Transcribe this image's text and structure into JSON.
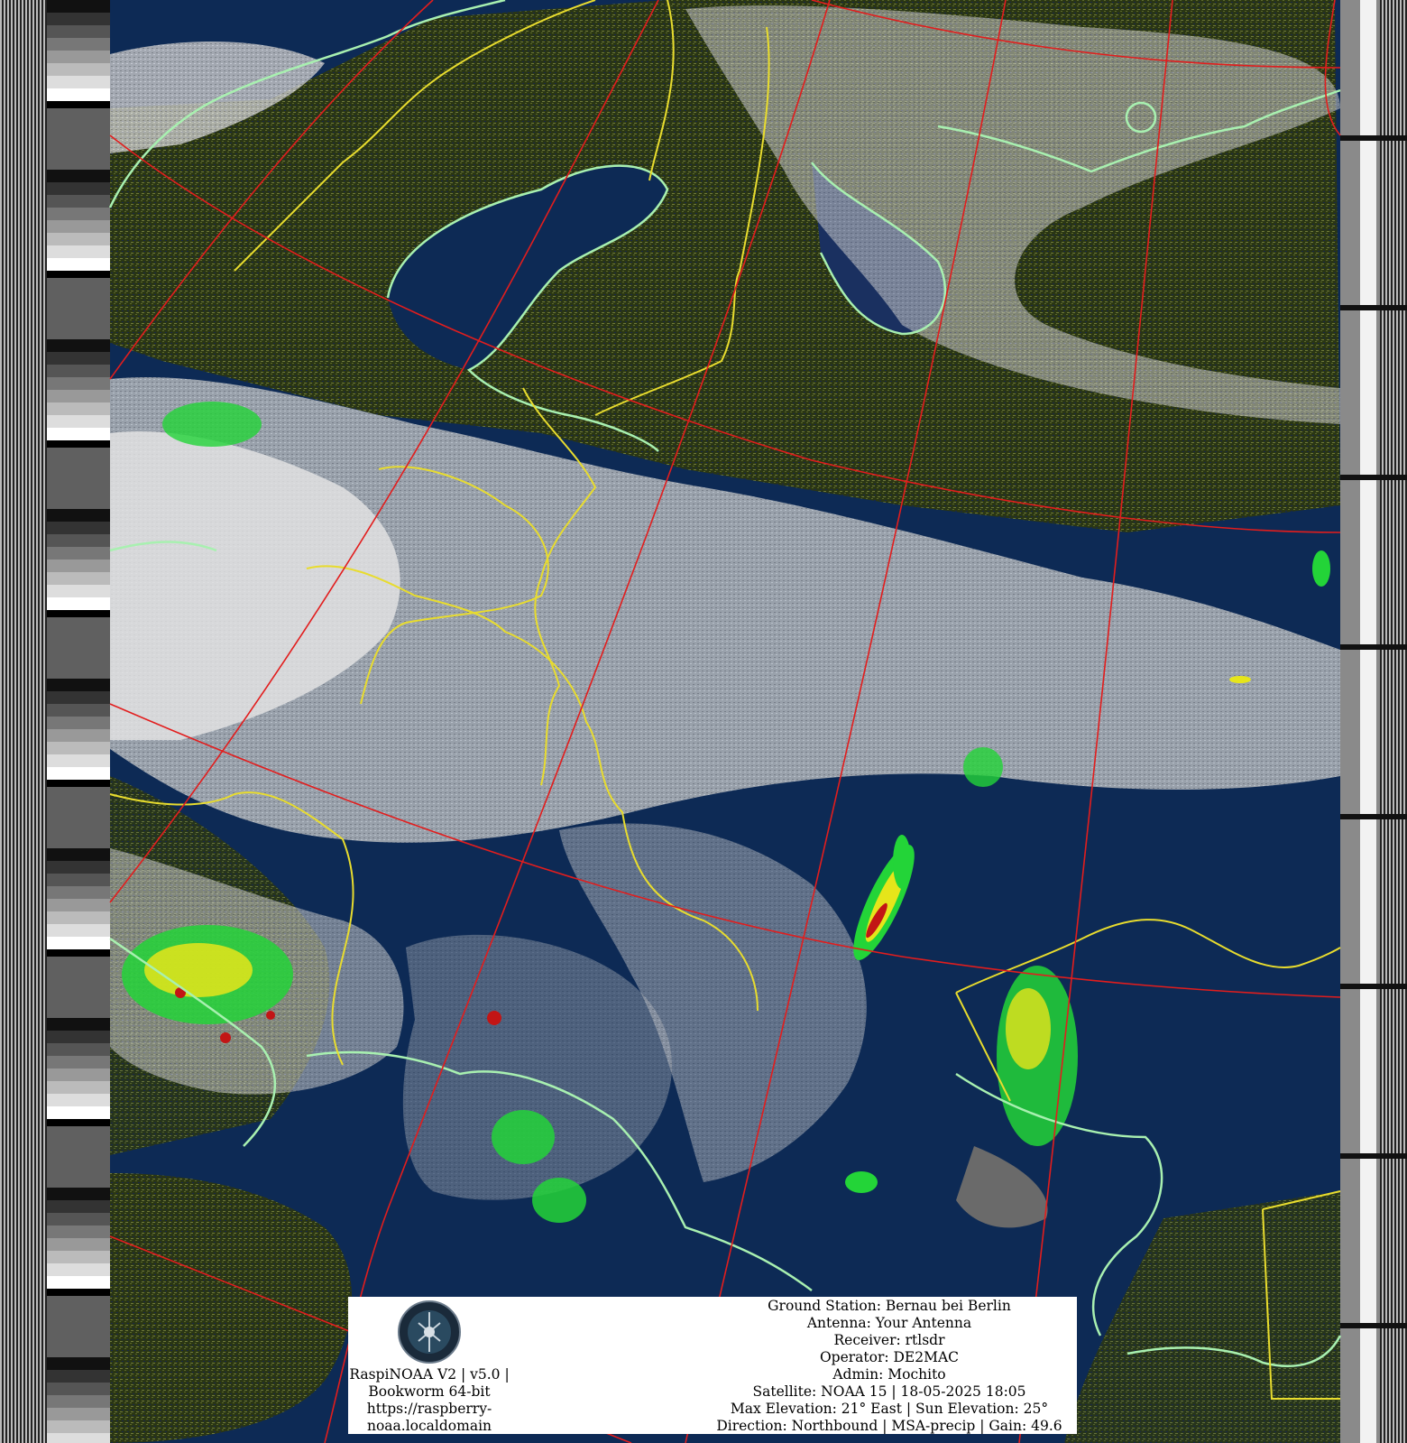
{
  "colors": {
    "sea": "#0d2a55",
    "land_dark": "#3c4616",
    "land_light": "#7d8a3b",
    "cloud": "#d8d8d8",
    "precip_green": "#23d438",
    "precip_yellow": "#e6e51a",
    "precip_red": "#c21515",
    "grid_red": "#e21d1d",
    "border_yellow": "#e8dc2e",
    "coast_green": "#a8f0b0"
  },
  "logo": {
    "icon": "satellite-ground-station-emblem-icon"
  },
  "caption_left": {
    "line1": "RaspiNOAA V2 | v5.0 |",
    "line2": "Bookworm 64-bit",
    "line3": "https://raspberry-",
    "line4": "noaa.localdomain"
  },
  "caption_right": {
    "ground_station": "Ground Station: Bernau bei Berlin",
    "antenna": "Antenna: Your Antenna",
    "receiver": "Receiver: rtlsdr",
    "operator": "Operator: DE2MAC",
    "admin": "Admin: Mochito",
    "satellite": "Satellite: NOAA 15 | 18-05-2025 18:05",
    "elevation": "Max Elevation: 21° East | Sun Elevation: 25°",
    "direction": "Direction: Northbound | MSA-precip | Gain: 49.6"
  }
}
